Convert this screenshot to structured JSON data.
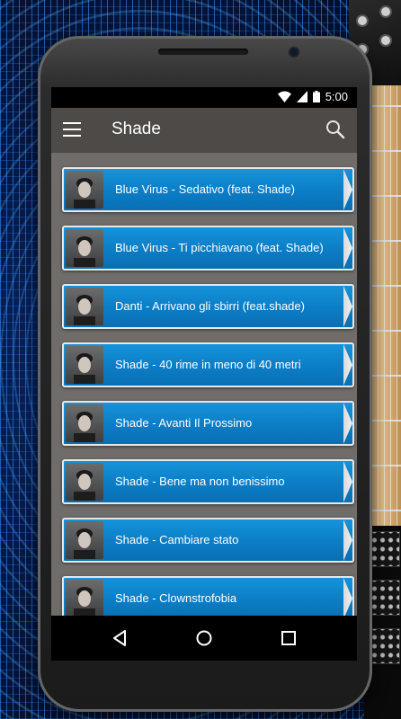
{
  "status_bar": {
    "time": "5:00"
  },
  "app_bar": {
    "title": "Shade"
  },
  "list": {
    "items": [
      {
        "label": "Blue Virus - Sedativo (feat. Shade)"
      },
      {
        "label": "Blue Virus - Ti picchiavano (feat. Shade)"
      },
      {
        "label": "Danti - Arrivano gli sbirri (feat.shade)"
      },
      {
        "label": "Shade - 40 rime in meno di 40 metri"
      },
      {
        "label": "Shade - Avanti Il Prossimo"
      },
      {
        "label": "Shade - Bene ma non benissimo"
      },
      {
        "label": "Shade - Cambiare stato"
      },
      {
        "label": "Shade - Clownstrofobia"
      }
    ]
  },
  "icons": {
    "menu": "menu-icon",
    "search": "search-icon",
    "wifi": "wifi-icon",
    "signal": "signal-icon",
    "battery": "battery-icon",
    "back": "back-icon",
    "home": "home-icon",
    "recents": "recents-icon"
  },
  "colors": {
    "item_background": "#0b7dc6",
    "app_bar": "#4d4a47",
    "list_background": "#6f6c69"
  }
}
